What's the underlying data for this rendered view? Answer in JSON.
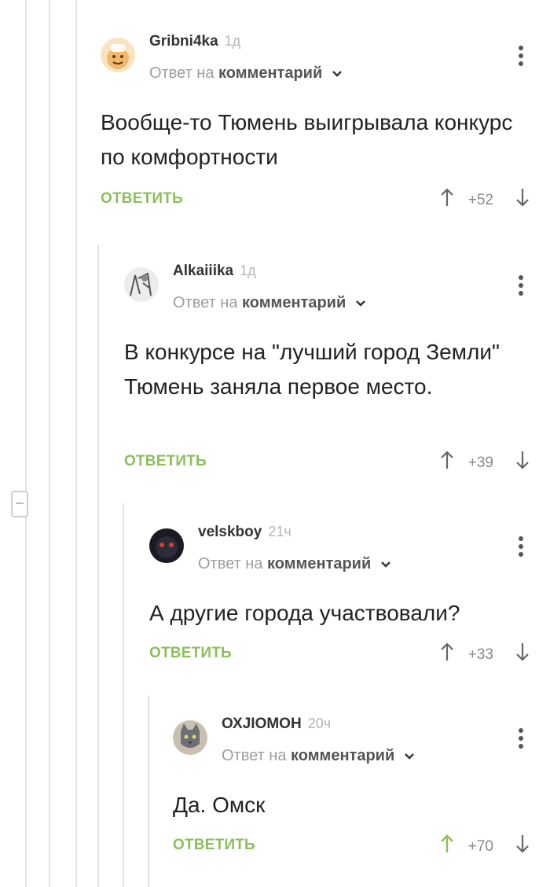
{
  "comments": [
    {
      "username": "Gribni4ka",
      "time": "1д",
      "reply_prefix": "Ответ на",
      "reply_target": "комментарий",
      "text": "Вообще-то Тюмень выигрывала конкурс по комфортности",
      "reply_label": "ОТВЕТИТЬ",
      "score": "+52",
      "upvoted": false,
      "avatar": "chef-avatar"
    },
    {
      "username": "Alkaiiika",
      "time": "1д",
      "reply_prefix": "Ответ на",
      "reply_target": "комментарий",
      "text": "В конкурсе на \"лучший город Земли\" Тюмень заняла первое место.",
      "reply_label": "ОТВЕТИТЬ",
      "score": "+39",
      "upvoted": false,
      "avatar": "sketch-avatar"
    },
    {
      "username": "velskboy",
      "time": "21ч",
      "reply_prefix": "Ответ на",
      "reply_target": "комментарий",
      "text": "А другие города участвовали?",
      "reply_label": "ОТВЕТИТЬ",
      "score": "+33",
      "upvoted": false,
      "avatar": "dark-creature-avatar"
    },
    {
      "username": "ОХЈІОМОН",
      "time": "20ч",
      "reply_prefix": "Ответ на",
      "reply_target": "комментарий",
      "text": "Да. Омск",
      "reply_label": "ОТВЕТИТЬ",
      "score": "+70",
      "upvoted": true,
      "avatar": "cat-avatar"
    }
  ],
  "colors": {
    "accent_green": "#8cbf5a",
    "upvote_active": "#8cbf5a",
    "muted_text": "#9e9e9e",
    "rail": "#e3e3e3"
  }
}
